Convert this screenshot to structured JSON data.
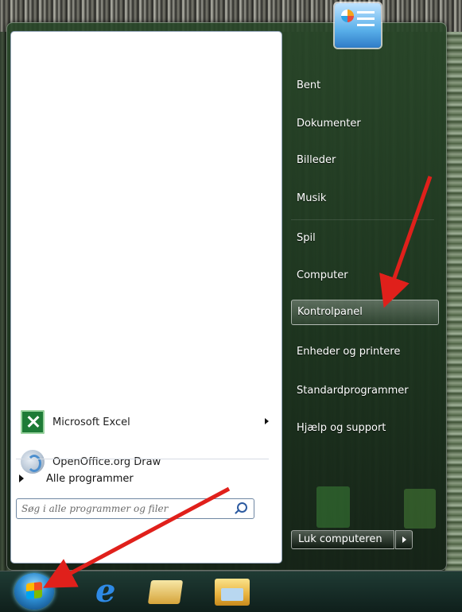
{
  "start_menu": {
    "left_pane": {
      "pinned_programs": [
        {
          "label": "Microsoft Excel",
          "icon": "excel-icon",
          "has_submenu": true
        },
        {
          "label": "OpenOffice.org Draw",
          "icon": "openoffice-draw-icon",
          "has_submenu": false
        }
      ],
      "all_programs_label": "Alle programmer",
      "search": {
        "placeholder": "Søg i alle programmer og filer",
        "value": ""
      }
    },
    "right_pane": {
      "user_picture_icon": "user-picture-icon",
      "items": [
        {
          "label": "Bent"
        },
        {
          "label": "Dokumenter"
        },
        {
          "label": "Billeder"
        },
        {
          "label": "Musik"
        },
        {
          "label": "Spil"
        },
        {
          "label": "Computer"
        },
        {
          "label": "Kontrolpanel",
          "highlighted": true
        },
        {
          "label": "Enheder og printere"
        },
        {
          "label": "Standardprogrammer"
        },
        {
          "label": "Hjælp og support"
        }
      ],
      "shutdown_label": "Luk computeren"
    }
  },
  "taskbar": {
    "icons": [
      "windows-start-orb-icon",
      "internet-explorer-icon",
      "mail-icon",
      "windows-explorer-icon"
    ]
  },
  "annotations": {
    "arrow_color": "#e0201b"
  }
}
